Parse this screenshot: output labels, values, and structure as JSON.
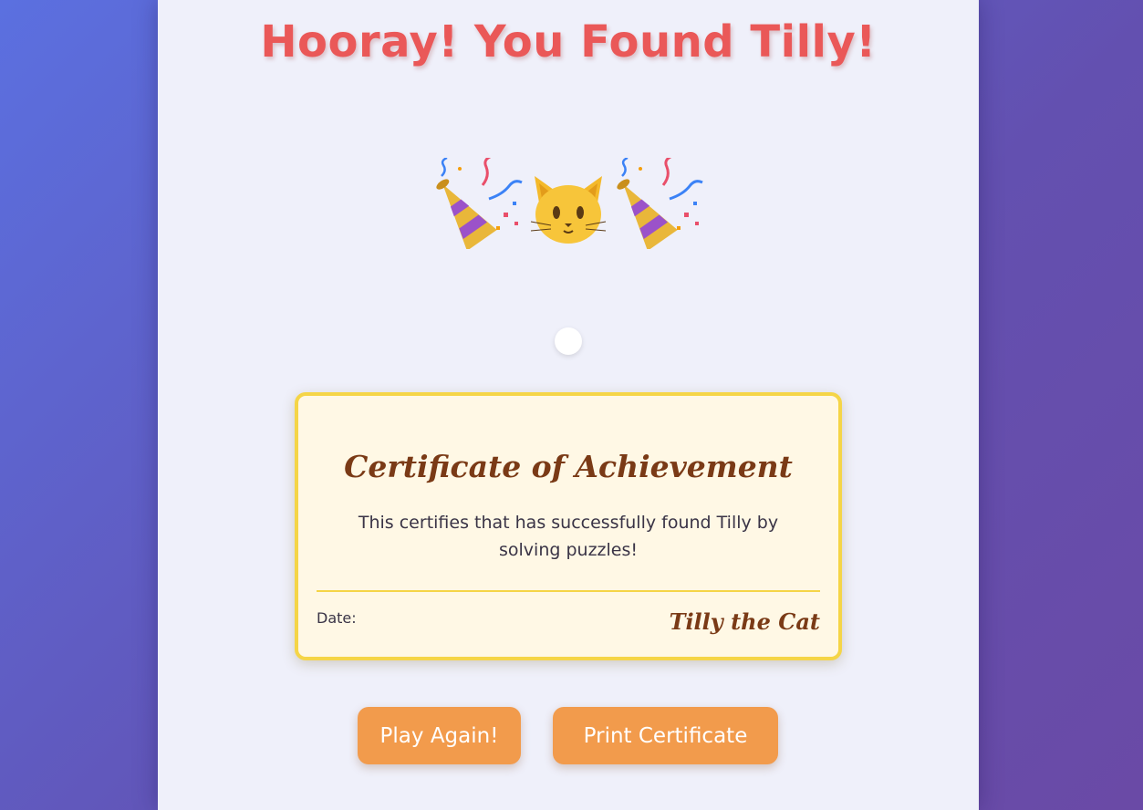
{
  "header": {
    "title": "Hooray! You Found Tilly!"
  },
  "celebration": {
    "icons": [
      "party-popper",
      "cat-face",
      "party-popper"
    ]
  },
  "certificate": {
    "title": "Certificate of Achievement",
    "body": "This certifies that has successfully found Tilly by solving puzzles!",
    "date_label": "Date:",
    "signature": "Tilly the Cat"
  },
  "actions": {
    "play_again": "Play Again!",
    "print_certificate": "Print Certificate"
  },
  "colors": {
    "title": "#ea5858",
    "certificate_border": "#f5d547",
    "certificate_bg": "#fff8e5",
    "certificate_text": "#7a3a16",
    "button": "#f29b4c"
  }
}
